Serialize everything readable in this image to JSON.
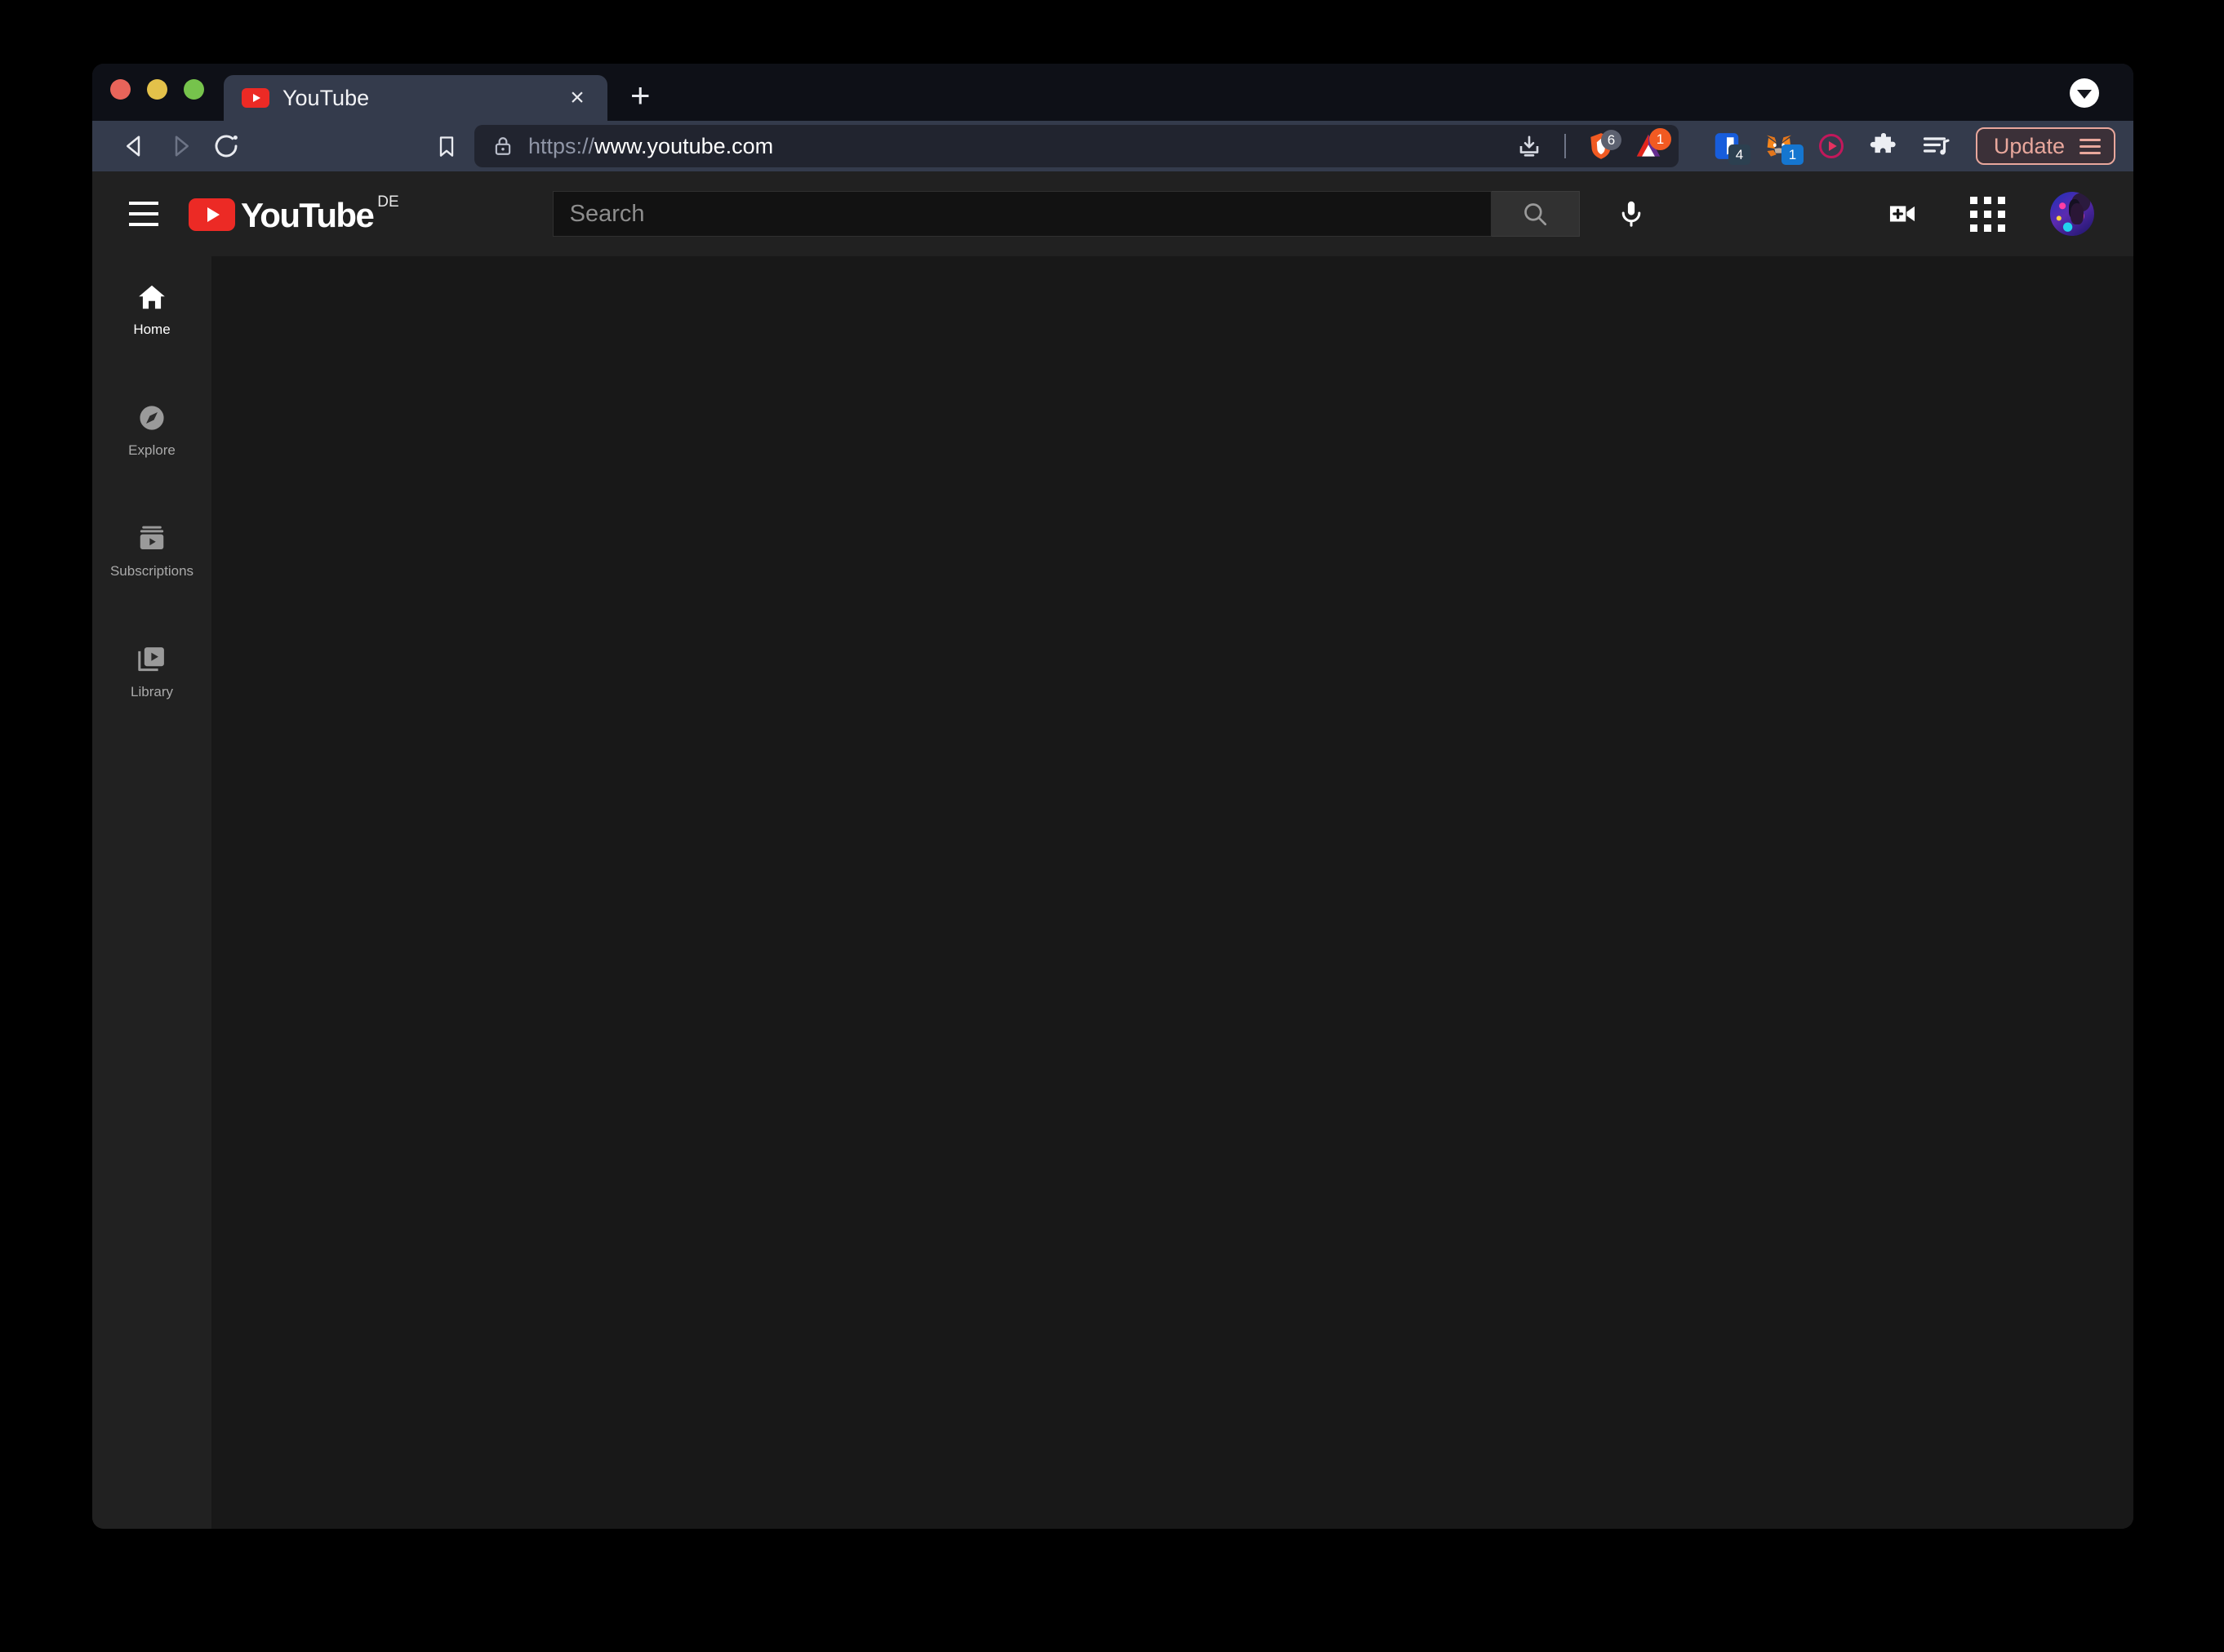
{
  "window": {
    "traffic_lights": [
      "close",
      "minimize",
      "maximize"
    ],
    "colors": {
      "tabstrip_bg": "#0e1017",
      "toolbar_bg": "#343b4c",
      "active_tab_bg": "#343b4c",
      "yt_header_bg": "#212121",
      "yt_sidebar_bg": "#212121",
      "yt_content_bg": "#181818",
      "yt_red": "#ec2a25",
      "update_accent": "#e8a79c"
    }
  },
  "tabs": [
    {
      "title": "YouTube",
      "favicon": "youtube-icon",
      "close_label": "×",
      "active": true
    }
  ],
  "tabstrip": {
    "new_tab_label": "+",
    "tab_list_chevron": "chevron-down-icon"
  },
  "toolbar": {
    "back_label": "back-icon",
    "forward_label": "forward-icon",
    "reload_label": "reload-icon",
    "bookmark_label": "bookmark-icon",
    "address": {
      "lock_icon": "lock-icon",
      "scheme": "https://",
      "host": "www.youtube.com",
      "full_url": "https://www.youtube.com"
    },
    "address_actions": [
      {
        "name": "download-icon",
        "badge": null
      },
      {
        "name": "brave-shield-icon",
        "badge": "6"
      },
      {
        "name": "brave-rewards-icon",
        "badge": "1"
      }
    ],
    "extensions": [
      {
        "name": "bitwarden-icon",
        "badge": "4"
      },
      {
        "name": "metamask-icon",
        "badge": "1"
      },
      {
        "name": "media-player-icon",
        "badge": null
      },
      {
        "name": "extensions-puzzle-icon",
        "badge": null
      },
      {
        "name": "playlist-icon",
        "badge": null
      }
    ],
    "update_button": {
      "label": "Update",
      "menu_icon": "hamburger-icon"
    }
  },
  "youtube": {
    "header": {
      "guide_button": "hamburger-icon",
      "logo_text": "YouTube",
      "country_code": "DE",
      "search": {
        "placeholder": "Search",
        "value": "",
        "search_button_icon": "search-icon",
        "mic_button_icon": "microphone-icon"
      },
      "actions": [
        {
          "name": "create-video-icon",
          "label": "Create"
        },
        {
          "name": "apps-grid-icon",
          "label": "YouTube apps"
        },
        {
          "name": "avatar",
          "label": "Account"
        }
      ]
    },
    "sidebar": {
      "items": [
        {
          "label": "Home",
          "icon": "home-icon",
          "active": true
        },
        {
          "label": "Explore",
          "icon": "compass-icon",
          "active": false
        },
        {
          "label": "Subscriptions",
          "icon": "subscriptions-icon",
          "active": false
        },
        {
          "label": "Library",
          "icon": "library-icon",
          "active": false
        }
      ]
    },
    "content": {
      "empty": true
    }
  }
}
